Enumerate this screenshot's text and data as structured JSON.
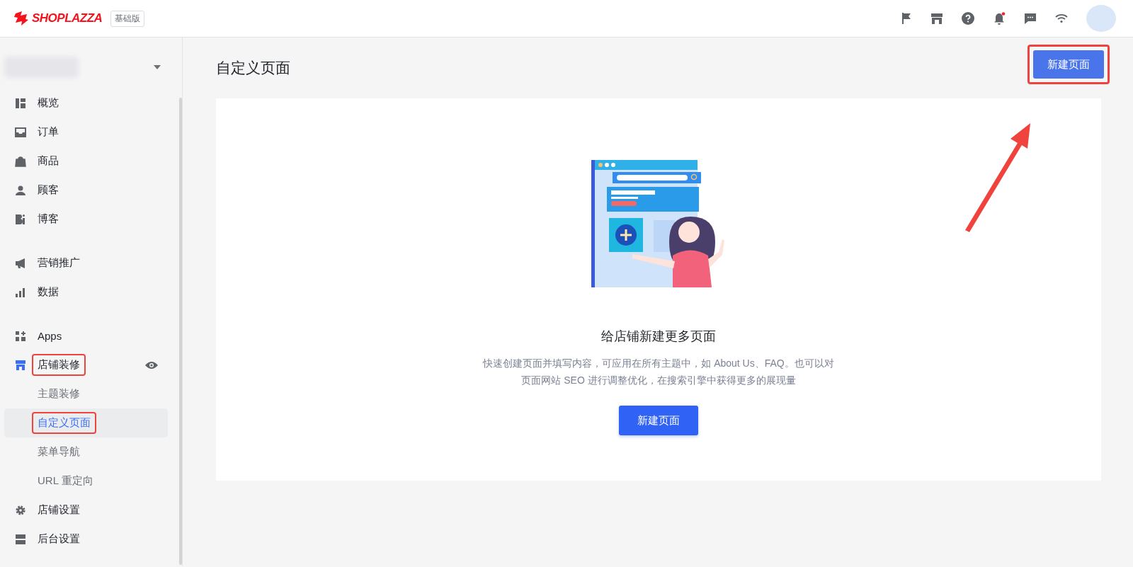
{
  "header": {
    "logo": "SHOPLAZZA",
    "plan_badge": "基础版",
    "notification_unread": true
  },
  "sidebar": {
    "groups": [
      {
        "items": [
          {
            "label": "概览",
            "selected": false,
            "highlighted": false
          },
          {
            "label": "订单",
            "selected": false,
            "highlighted": false
          },
          {
            "label": "商品",
            "selected": false,
            "highlighted": false
          },
          {
            "label": "顾客",
            "selected": false,
            "highlighted": false
          },
          {
            "label": "博客",
            "selected": false,
            "highlighted": false
          }
        ]
      },
      {
        "items": [
          {
            "label": "营销推广",
            "selected": false,
            "highlighted": false
          },
          {
            "label": "数据",
            "selected": false,
            "highlighted": false
          }
        ]
      },
      {
        "items": [
          {
            "label": "Apps",
            "selected": false,
            "highlighted": false
          },
          {
            "label": "店铺装修",
            "selected": false,
            "active": true,
            "highlighted": true,
            "children": [
              {
                "label": "主题装修",
                "selected": false,
                "highlighted": false
              },
              {
                "label": "自定义页面",
                "selected": true,
                "highlighted": true
              },
              {
                "label": "菜单导航",
                "selected": false,
                "highlighted": false
              },
              {
                "label": "URL 重定向",
                "selected": false,
                "highlighted": false
              }
            ]
          },
          {
            "label": "店铺设置",
            "selected": false,
            "highlighted": false
          },
          {
            "label": "后台设置",
            "selected": false,
            "highlighted": false
          }
        ]
      }
    ]
  },
  "page": {
    "title": "自定义页面",
    "primary_button": {
      "label": "新建页面",
      "highlighted": true
    }
  },
  "empty_state": {
    "title": "给店铺新建更多页面",
    "description": "快速创建页面并填写内容，可应用在所有主题中，如 About Us、FAQ。也可以对页面网站 SEO 进行调整优化，在搜索引擎中获得更多的展现量",
    "button": "新建页面"
  }
}
